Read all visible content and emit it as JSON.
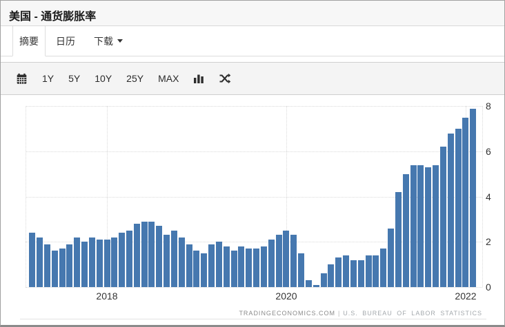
{
  "header": {
    "title": "美国 - 通货膨胀率"
  },
  "tabs": {
    "items": [
      {
        "label": "摘要",
        "active": true
      },
      {
        "label": "日历",
        "active": false
      },
      {
        "label": "下载",
        "active": false,
        "caret": true
      }
    ]
  },
  "toolbar": {
    "ranges": [
      "1Y",
      "5Y",
      "10Y",
      "25Y",
      "MAX"
    ],
    "icons": [
      "calendar-icon",
      "bar-chart-icon",
      "shuffle-icon"
    ]
  },
  "chart_data": {
    "type": "bar",
    "title": "美国 - 通货膨胀率",
    "ylabel": "",
    "xlabel": "",
    "ylim": [
      0,
      8
    ],
    "yticks": [
      0,
      2,
      4,
      6,
      8
    ],
    "grid": "dotted",
    "legend": "none",
    "bar_color": "#4678af",
    "x": [
      "2017-03",
      "2017-04",
      "2017-05",
      "2017-06",
      "2017-07",
      "2017-08",
      "2017-09",
      "2017-10",
      "2017-11",
      "2017-12",
      "2018-01",
      "2018-02",
      "2018-03",
      "2018-04",
      "2018-05",
      "2018-06",
      "2018-07",
      "2018-08",
      "2018-09",
      "2018-10",
      "2018-11",
      "2018-12",
      "2019-01",
      "2019-02",
      "2019-03",
      "2019-04",
      "2019-05",
      "2019-06",
      "2019-07",
      "2019-08",
      "2019-09",
      "2019-10",
      "2019-11",
      "2019-12",
      "2020-01",
      "2020-02",
      "2020-03",
      "2020-04",
      "2020-05",
      "2020-06",
      "2020-07",
      "2020-08",
      "2020-09",
      "2020-10",
      "2020-11",
      "2020-12",
      "2021-01",
      "2021-02",
      "2021-03",
      "2021-04",
      "2021-05",
      "2021-06",
      "2021-07",
      "2021-08",
      "2021-09",
      "2021-10",
      "2021-11",
      "2021-12",
      "2022-01",
      "2022-02"
    ],
    "values": [
      2.4,
      2.2,
      1.9,
      1.6,
      1.7,
      1.9,
      2.2,
      2.0,
      2.2,
      2.1,
      2.1,
      2.2,
      2.4,
      2.5,
      2.8,
      2.9,
      2.9,
      2.7,
      2.3,
      2.5,
      2.2,
      1.9,
      1.6,
      1.5,
      1.9,
      2.0,
      1.8,
      1.6,
      1.8,
      1.7,
      1.7,
      1.8,
      2.1,
      2.3,
      2.5,
      2.3,
      1.5,
      0.3,
      0.1,
      0.6,
      1.0,
      1.3,
      1.4,
      1.2,
      1.2,
      1.4,
      1.4,
      1.7,
      2.6,
      4.2,
      5.0,
      5.4,
      5.4,
      5.3,
      5.4,
      6.2,
      6.8,
      7.0,
      7.5,
      7.9
    ],
    "xticks": [
      {
        "label": "2018",
        "index": 10
      },
      {
        "label": "2020",
        "index": 34
      },
      {
        "label": "2022",
        "index": 58
      }
    ],
    "attribution": {
      "source": "TRADINGECONOMICS.COM",
      "separator": "|",
      "provider": "U.S.  BUREAU  OF  LABOR  STATISTICS"
    }
  }
}
